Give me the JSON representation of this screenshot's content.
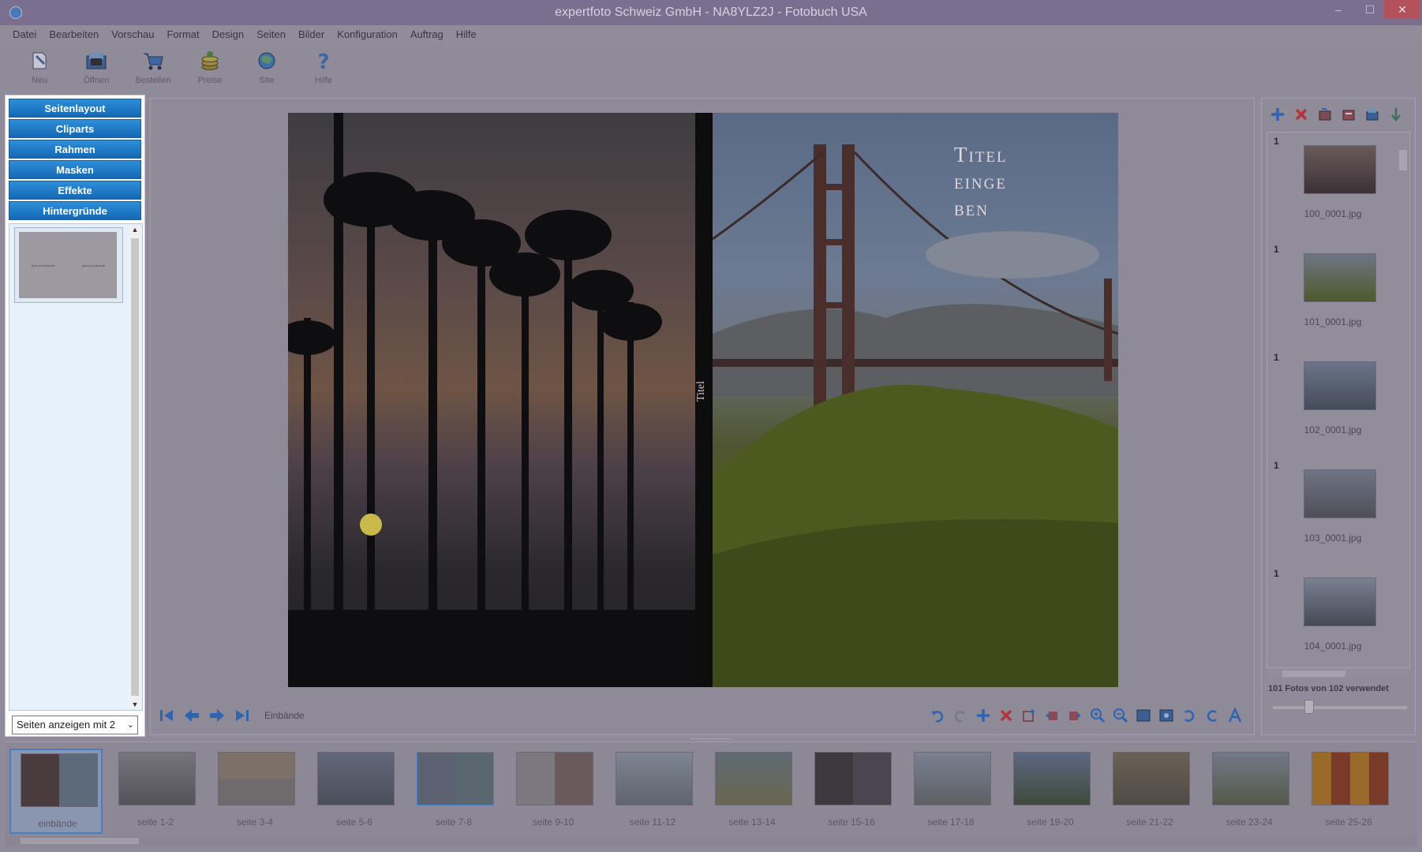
{
  "window": {
    "title": "expertfoto Schweiz GmbH - NA8YLZ2J - Fotobuch USA",
    "min_glyph": "–",
    "max_glyph": "☐",
    "close_glyph": "✕"
  },
  "menu": [
    "Datei",
    "Bearbeiten",
    "Vorschau",
    "Format",
    "Design",
    "Seiten",
    "Bilder",
    "Konfiguration",
    "Auftrag",
    "Hilfe"
  ],
  "toolbar": [
    {
      "label": "Neu",
      "icon": "new-icon"
    },
    {
      "label": "Öffnen",
      "icon": "open-icon"
    },
    {
      "label": "Bestellen",
      "icon": "cart-icon"
    },
    {
      "label": "Preise",
      "icon": "coins-icon"
    },
    {
      "label": "Site",
      "icon": "globe-icon"
    },
    {
      "label": "Hilfe",
      "icon": "help-icon"
    }
  ],
  "left_panel": {
    "categories": [
      "Seitenlayout",
      "Cliparts",
      "Rahmen",
      "Masken",
      "Effekte",
      "Hintergründe"
    ],
    "layout_thumb_left": "pick your picture",
    "layout_thumb_right": "pick your picture",
    "pages_select": "Seiten anzeigen mit 2"
  },
  "editor": {
    "spine_text": "Titel",
    "title_text": "Titel\neinge\nben",
    "nav_label": "Einbände"
  },
  "right_panel": {
    "photos": [
      {
        "num": "1",
        "name": "100_0001.jpg"
      },
      {
        "num": "1",
        "name": "101_0001.jpg"
      },
      {
        "num": "1",
        "name": "102_0001.jpg"
      },
      {
        "num": "1",
        "name": "103_0001.jpg"
      },
      {
        "num": "1",
        "name": "104_0001.jpg"
      }
    ],
    "count_text": "101 Fotos von 102 verwendet"
  },
  "filmstrip": [
    "einbände",
    "seite 1-2",
    "seite 3-4",
    "seite 5-6",
    "seite 7-8",
    "seite 9-10",
    "seite 11-12",
    "seite 13-14",
    "seite 15-16",
    "seite 17-18",
    "seite 19-20",
    "seite 21-22",
    "seite 23-24",
    "seite 25-26"
  ],
  "colors": {
    "accent": "#1f7acb",
    "selected_border": "#4a7ec2"
  }
}
